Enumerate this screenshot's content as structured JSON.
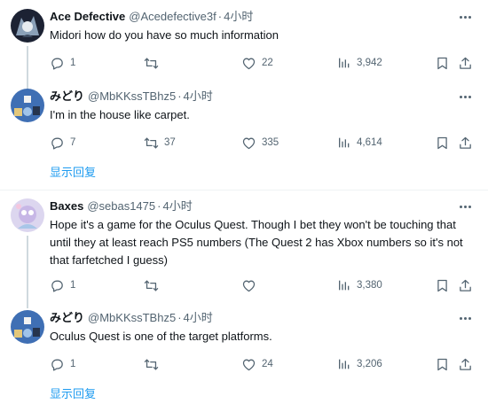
{
  "tweets": [
    {
      "name": "Ace Defective",
      "handle": "@Acedefective3f",
      "sep": "·",
      "time": "4小时",
      "text": "Midori how do you have so much information",
      "replies": "1",
      "retweets": "",
      "likes": "22",
      "views": "3,942"
    },
    {
      "name": "みどり",
      "handle": "@MbKKssTBhz5",
      "sep": "·",
      "time": "4小时",
      "text": "I'm in the house like carpet.",
      "replies": "7",
      "retweets": "37",
      "likes": "335",
      "views": "4,614",
      "show_replies": "显示回复"
    },
    {
      "name": "Baxes",
      "handle": "@sebas1475",
      "sep": "·",
      "time": "4小时",
      "text": "Hope it's a game for the Oculus Quest. Though I bet they won't be touching that until they at least reach PS5 numbers (The Quest 2 has Xbox numbers so it's not that farfetched I guess)",
      "replies": "1",
      "retweets": "",
      "likes": "",
      "views": "3,380"
    },
    {
      "name": "みどり",
      "handle": "@MbKKssTBhz5",
      "sep": "·",
      "time": "4小时",
      "text": "Oculus Quest is one of the target platforms.",
      "replies": "1",
      "retweets": "",
      "likes": "24",
      "views": "3,206",
      "show_replies": "显示回复"
    }
  ],
  "icons": {
    "reply": "reply-icon",
    "retweet": "retweet-icon",
    "like": "like-icon",
    "views": "views-icon",
    "bookmark": "bookmark-icon",
    "share": "share-icon",
    "more": "more-icon"
  },
  "colors": {
    "text": "#0f1419",
    "secondary": "#536471",
    "accent": "#1d9bf0",
    "thread_line": "#cfd9de",
    "divider": "#eff3f4"
  }
}
